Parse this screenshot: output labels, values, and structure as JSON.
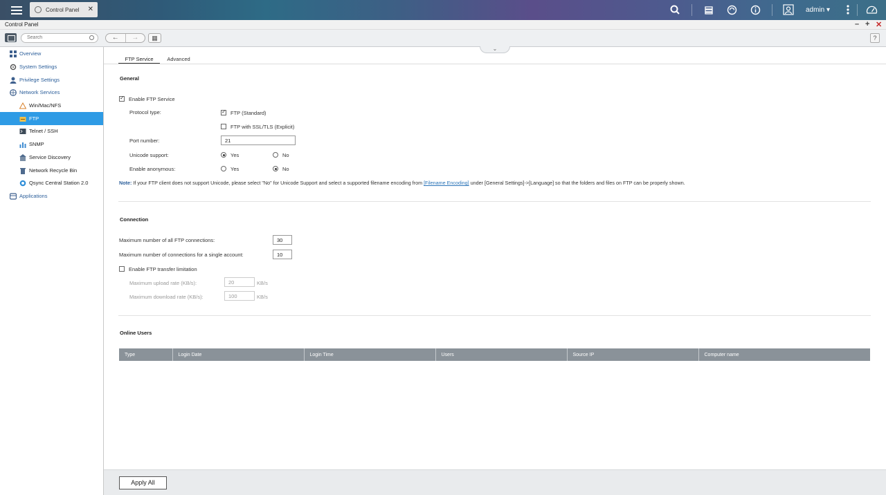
{
  "topbar": {
    "app_tab_title": "Control Panel",
    "user_name": "admin"
  },
  "window": {
    "title": "Control Panel"
  },
  "toolbar": {
    "search_placeholder": "Search"
  },
  "sidebar": {
    "items": [
      {
        "label": "Overview",
        "icon": "overview-icon"
      },
      {
        "label": "System Settings",
        "icon": "system-settings-icon"
      },
      {
        "label": "Privilege Settings",
        "icon": "privilege-icon"
      },
      {
        "label": "Network Services",
        "icon": "network-services-icon"
      },
      {
        "label": "Win/Mac/NFS",
        "icon": "win-mac-nfs-icon"
      },
      {
        "label": "FTP",
        "icon": "ftp-icon"
      },
      {
        "label": "Telnet / SSH",
        "icon": "terminal-icon"
      },
      {
        "label": "SNMP",
        "icon": "snmp-icon"
      },
      {
        "label": "Service Discovery",
        "icon": "service-discovery-icon"
      },
      {
        "label": "Network Recycle Bin",
        "icon": "recycle-bin-icon"
      },
      {
        "label": "Qsync Central Station 2.0",
        "icon": "qsync-icon"
      },
      {
        "label": "Applications",
        "icon": "applications-icon"
      }
    ]
  },
  "tabs": [
    "FTP Service",
    "Advanced"
  ],
  "general": {
    "title": "General",
    "enable_ftp": "Enable FTP Service",
    "protocol_label": "Protocol type:",
    "protocol_standard": "FTP (Standard)",
    "protocol_ssl": "FTP with SSL/TLS (Explicit)",
    "port_label": "Port number:",
    "port_value": "21",
    "unicode_label": "Unicode support:",
    "anonymous_label": "Enable anonymous:",
    "yes": "Yes",
    "no": "No",
    "note_label": "Note:",
    "note_text_1": " If your FTP client does not support Unicode, please select \"No\" for Unicode Support and select a supported filename encoding from ",
    "note_link": "[Filename Encoding]",
    "note_text_2": " under [General Settings]->[Language] so that the folders and files on FTP can be properly shown."
  },
  "connection": {
    "title": "Connection",
    "max_all_label": "Maximum number of all FTP connections:",
    "max_all_value": "30",
    "max_single_label": "Maximum number of connections for a single account:",
    "max_single_value": "10",
    "limit_label": "Enable FTP transfer limitation",
    "upload_label": "Maximum upload rate (KB/s):",
    "upload_value": "20",
    "download_label": "Maximum download rate (KB/s):",
    "download_value": "100",
    "unit": "KB/s"
  },
  "online_users": {
    "title": "Online Users",
    "columns": [
      "Type",
      "Login Date",
      "Login Time",
      "Users",
      "Source IP",
      "Computer name"
    ]
  },
  "footer": {
    "apply_label": "Apply All"
  }
}
